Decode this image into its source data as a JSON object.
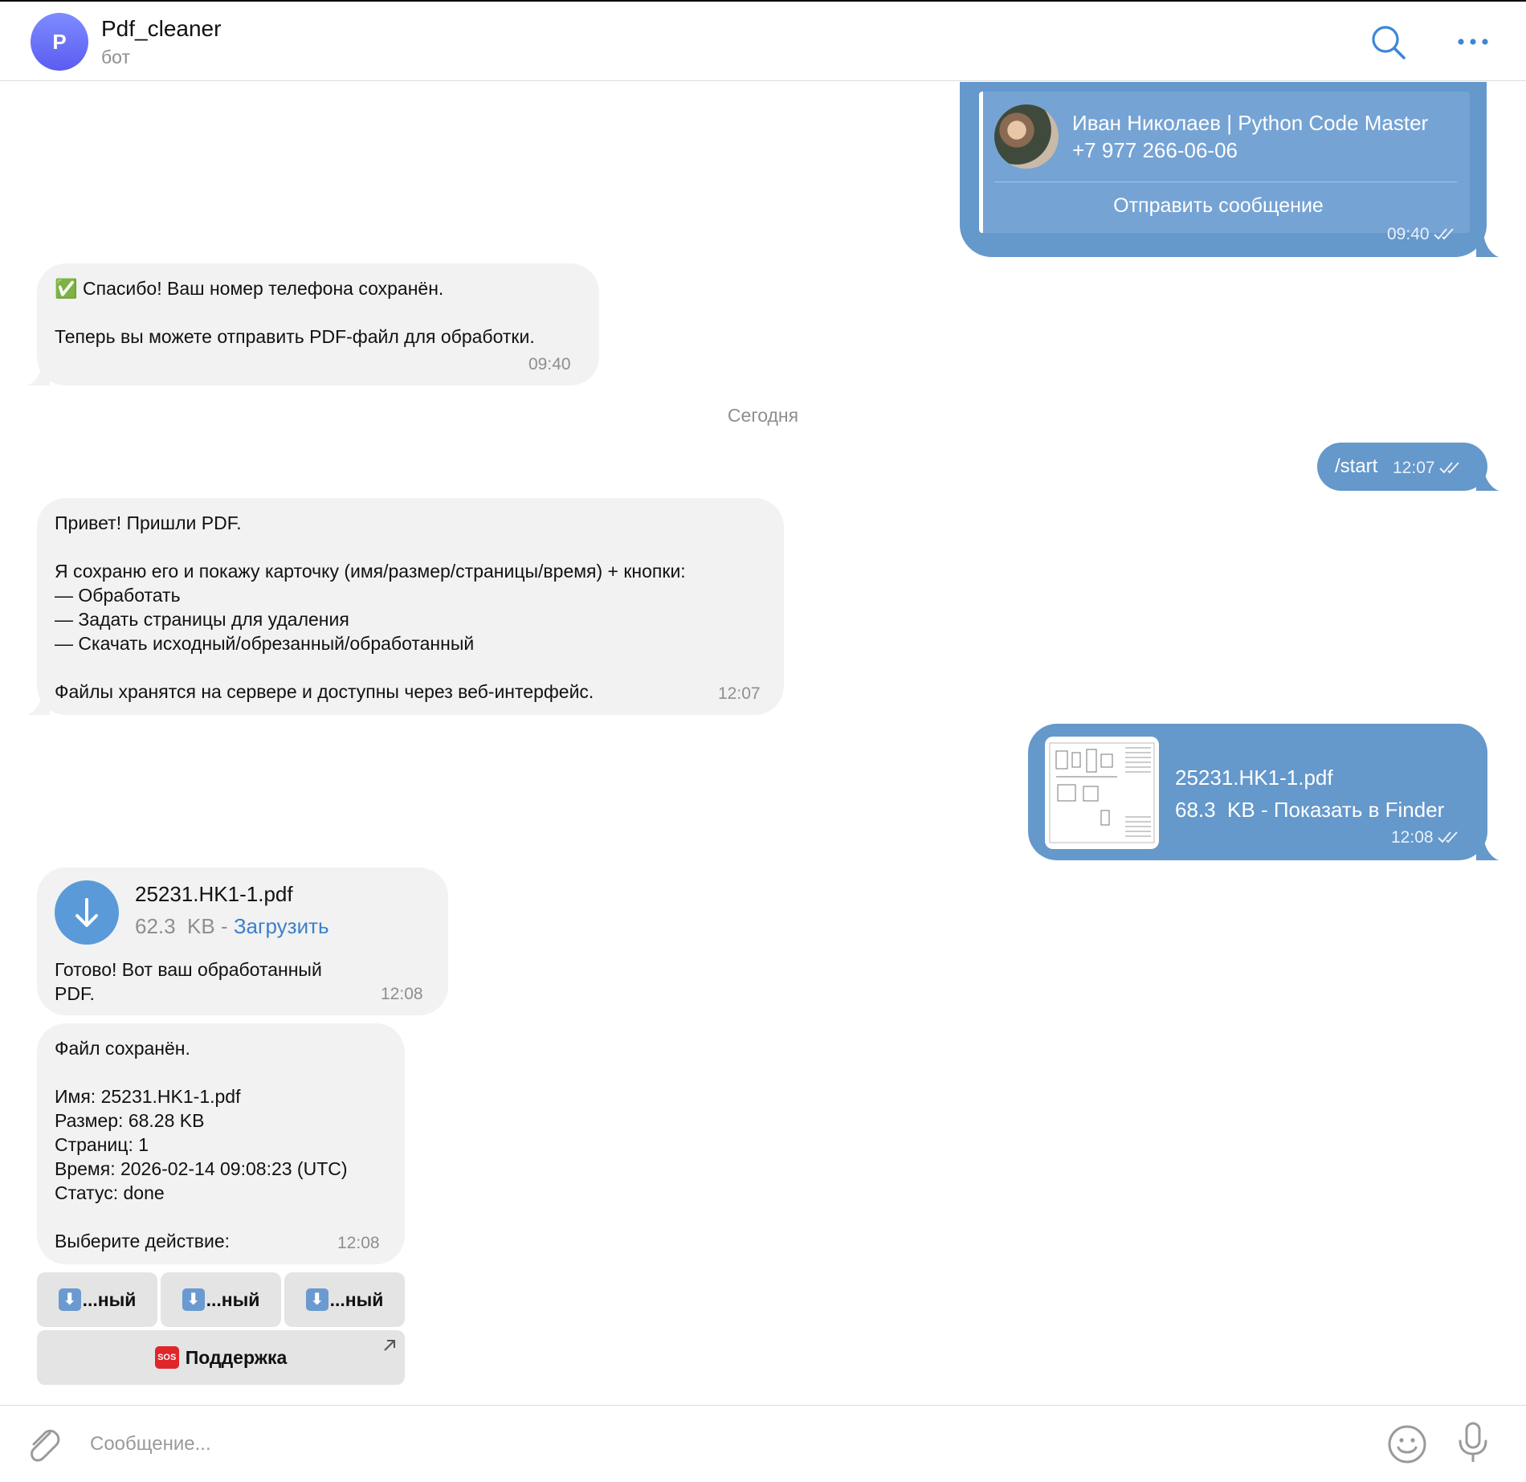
{
  "header": {
    "avatar_letter": "P",
    "title": "Pdf_cleaner",
    "subtitle": "бот",
    "icons": [
      "search-icon",
      "more-icon"
    ]
  },
  "messages": {
    "contact": {
      "name": "Иван Николаев | Python Code Master",
      "phone": "+7 977 266-06-06",
      "action": "Отправить сообщение",
      "time": "09:40"
    },
    "thanks": {
      "check": "✅",
      "text": "Спасибо! Ваш номер телефона сохранён.\n\nТеперь вы можете отправить PDF-файл для обработки.",
      "time": "09:40"
    },
    "date_separator": "Сегодня",
    "start": {
      "text": "/start",
      "time": "12:07"
    },
    "welcome": {
      "text": "Привет! Пришли PDF.\n\nЯ сохраню его и покажу карточку (имя/размер/страницы/время) + кнопки:\n— Обработать\n— Задать страницы для удаления\n— Скачать исходный/обрезанный/обработанный\n\nФайлы хранятся на сервере и доступны через веб-интерфейс.",
      "time": "12:07"
    },
    "sent_file": {
      "name": "25231.HK1-1.pdf",
      "size": "68.3  KB",
      "sep": " - ",
      "link": "Показать в Finder",
      "time": "12:08"
    },
    "received_file": {
      "name": "25231.HK1-1.pdf",
      "size": "62.3  KB",
      "sep": " - ",
      "link": "Загрузить",
      "caption": "Готово! Вот ваш обработанный\nPDF.",
      "time": "12:08"
    },
    "card": {
      "text": "Файл сохранён.\n\nИмя: 25231.HK1-1.pdf\nРазмер: 68.28 KB\nСтраниц: 1\nВремя: 2026-02-14 09:08:23 (UTC)\nСтатус: done\n\nВыберите действие:",
      "time": "12:08"
    }
  },
  "keyboard": {
    "row1": [
      {
        "emoji": "⬇",
        "label": "...ный"
      },
      {
        "emoji": "⬇",
        "label": "...ный"
      },
      {
        "emoji": "⬇",
        "label": "...ный"
      }
    ],
    "support": {
      "emoji": "SOS",
      "label": "Поддержка"
    }
  },
  "input": {
    "placeholder": "Сообщение..."
  },
  "colors": {
    "outgoing_bubble": "#6598cb",
    "incoming_bubble": "#f2f2f2",
    "accent": "#3d7fc9"
  }
}
